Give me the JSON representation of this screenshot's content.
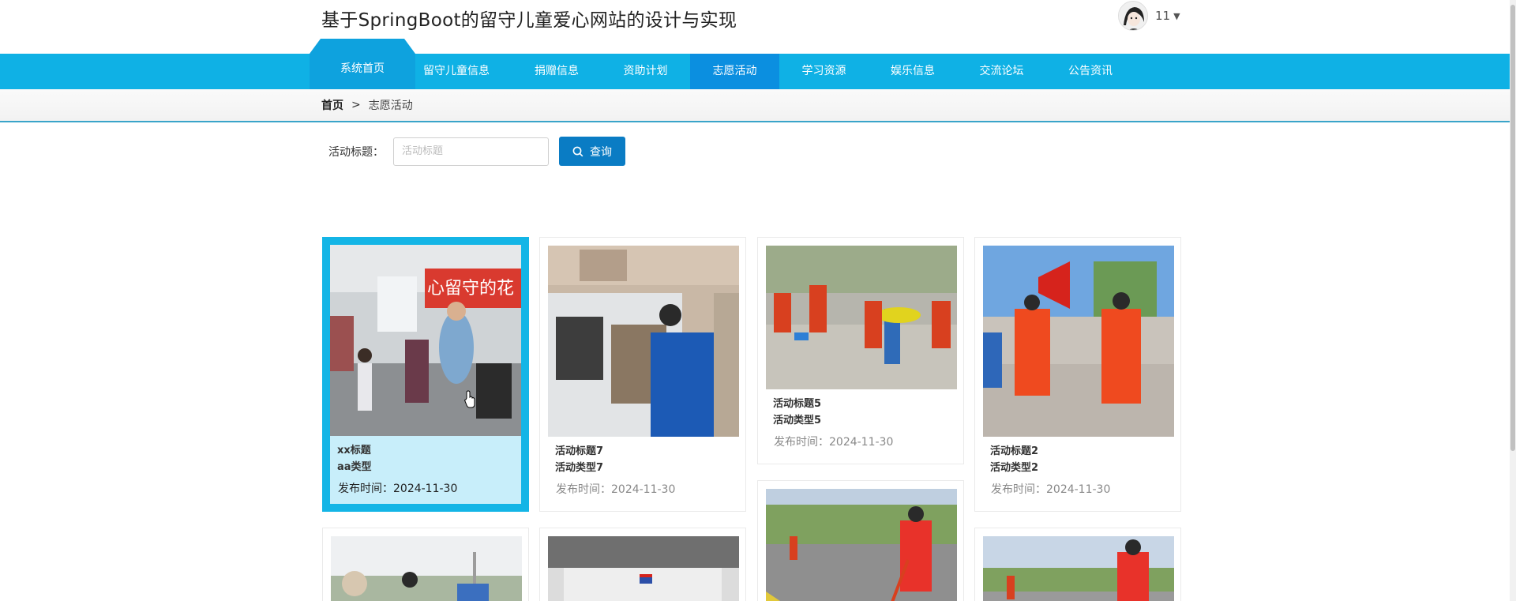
{
  "header": {
    "site_title": "基于SpringBoot的留守儿童爱心网站的设计与实现",
    "user_name": "11"
  },
  "nav": {
    "home": "系统首页",
    "items": [
      "留守儿童信息",
      "捐赠信息",
      "资助计划",
      "志愿活动",
      "学习资源",
      "娱乐信息",
      "交流论坛",
      "公告资讯"
    ],
    "active": "志愿活动"
  },
  "breadcrumb": {
    "home": "首页",
    "separator": ">",
    "current": "志愿活动"
  },
  "search": {
    "label": "活动标题：",
    "placeholder": "活动标题",
    "button": "查询"
  },
  "cards": [
    {
      "title": "xx标题",
      "type": "aa类型",
      "date": "发布时间：2024-11-30"
    },
    {
      "title": "活动标题7",
      "type": "活动类型7",
      "date": "发布时间：2024-11-30"
    },
    {
      "title": "活动标题5",
      "type": "活动类型5",
      "date": "发布时间：2024-11-30"
    },
    {
      "title": "活动标题2",
      "type": "活动类型2",
      "date": "发布时间：2024-11-30"
    },
    {
      "title": "",
      "type": "",
      "date": ""
    },
    {
      "title": "",
      "type": "",
      "date": ""
    },
    {
      "title": "",
      "type": "",
      "date": ""
    },
    {
      "title": "",
      "type": "",
      "date": ""
    }
  ],
  "colors": {
    "nav_bg": "#0fb1e5",
    "nav_active": "#0b8fe0",
    "search_button": "#0a7cc4",
    "card_hover": "#14b5e6"
  },
  "icons": {
    "search": "search-icon",
    "caret": "caret-down-icon",
    "avatar": "user-avatar"
  }
}
